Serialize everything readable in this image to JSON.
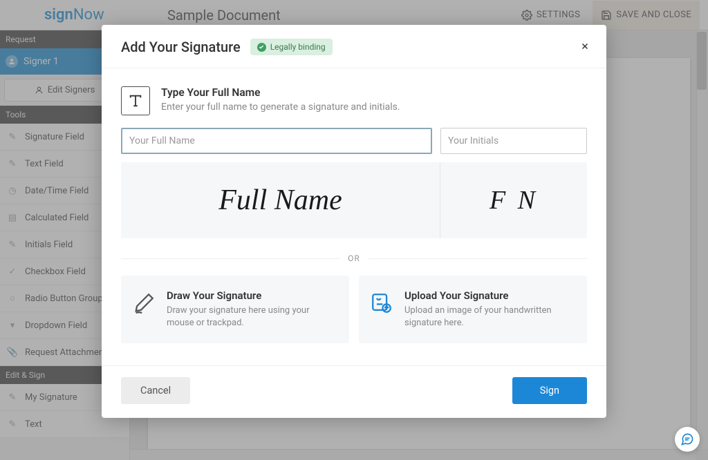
{
  "header": {
    "logo_a": "sign",
    "logo_b": "Now",
    "doc_title": "Sample Document",
    "settings_label": "SETTINGS",
    "save_close_label": "SAVE AND CLOSE"
  },
  "sidebar": {
    "section_request": "Request",
    "signer": "Signer 1",
    "edit_signers": "Edit Signers",
    "section_tools": "Tools",
    "tools": [
      "Signature Field",
      "Text Field",
      "Date/Time Field",
      "Calculated Field",
      "Initials Field",
      "Checkbox Field",
      "Radio Button Group",
      "Dropdown Field",
      "Request Attachment"
    ],
    "section_editsign": "Edit & Sign",
    "editsign_items": [
      "My Signature",
      "Text"
    ]
  },
  "modal": {
    "title": "Add Your Signature",
    "badge": "Legally binding",
    "type_heading": "Type Your Full Name",
    "type_desc": "Enter your full name to generate a signature and initials.",
    "name_placeholder": "Your Full Name",
    "initials_placeholder": "Your Initials",
    "preview_name": "Full Name",
    "preview_initials": "F N",
    "divider": "OR",
    "draw_title": "Draw Your Signature",
    "draw_desc": "Draw your signature here using your mouse or trackpad.",
    "upload_title": "Upload Your Signature",
    "upload_desc": "Upload an image of your handwritten signature here.",
    "cancel": "Cancel",
    "sign": "Sign"
  }
}
